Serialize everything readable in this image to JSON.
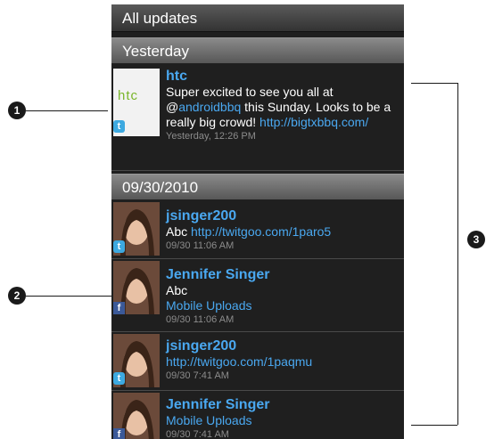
{
  "header": {
    "title": "All updates"
  },
  "sections": [
    {
      "label": "Yesterday"
    },
    {
      "label": "09/30/2010"
    }
  ],
  "posts": [
    {
      "user": "htc",
      "text": "Super excited to see you all at @",
      "mention": "androidbbq",
      "text2": " this Sunday. Looks to be a really big crowd! ",
      "link": "http://bigtxbbq.com/",
      "time": "Yesterday, 12:26 PM",
      "service": "twitter",
      "thumb": "htc"
    },
    {
      "user": "jsinger200",
      "text": "Abc ",
      "link": "http://twitgoo.com/1paro5",
      "time": "09/30 11:06 AM",
      "service": "twitter"
    },
    {
      "user": "Jennifer Singer",
      "text": "Abc",
      "link": "Mobile Uploads",
      "time": "09/30 11:06 AM",
      "service": "facebook"
    },
    {
      "user": "jsinger200",
      "link": "http://twitgoo.com/1paqmu",
      "time": "09/30 7:41 AM",
      "service": "twitter"
    },
    {
      "user": "Jennifer Singer",
      "link": "Mobile Uploads",
      "time": "09/30 7:41 AM",
      "service": "facebook"
    }
  ],
  "callouts": [
    "1",
    "2",
    "3"
  ],
  "icons": {
    "twitter_glyph": "t",
    "facebook_glyph": "f"
  },
  "colors": {
    "accent": "#4aa8f0",
    "twitter": "#3da9e0",
    "facebook": "#3b5998",
    "htc_green": "#79b52a"
  }
}
